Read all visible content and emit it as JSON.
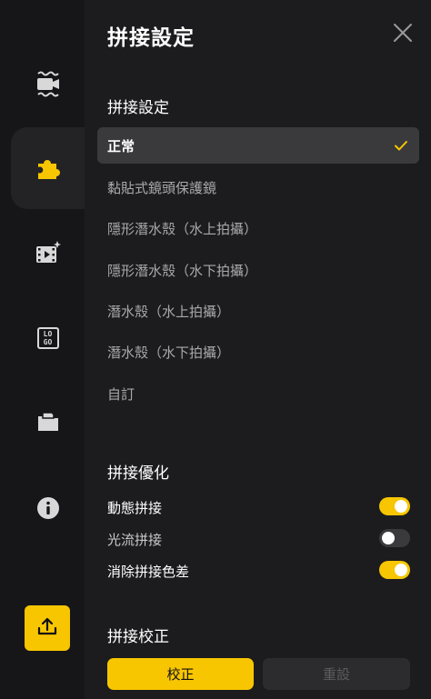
{
  "panel": {
    "title": "拼接設定"
  },
  "stitch_settings": {
    "heading": "拼接設定",
    "options": [
      {
        "label": "正常",
        "selected": true
      },
      {
        "label": "黏貼式鏡頭保護鏡",
        "selected": false
      },
      {
        "label": "隱形潛水殼（水上拍攝）",
        "selected": false
      },
      {
        "label": "隱形潛水殼（水下拍攝）",
        "selected": false
      },
      {
        "label": "潛水殼（水上拍攝）",
        "selected": false
      },
      {
        "label": "潛水殼（水下拍攝）",
        "selected": false
      },
      {
        "label": "自訂",
        "selected": false
      }
    ]
  },
  "stitch_optimize": {
    "heading": "拼接優化",
    "toggles": [
      {
        "label": "動態拼接",
        "on": true
      },
      {
        "label": "光流拼接",
        "on": false
      },
      {
        "label": "消除拼接色差",
        "on": true
      }
    ]
  },
  "stitch_calibrate": {
    "heading": "拼接校正",
    "calibrate_label": "校正",
    "reset_label": "重設"
  },
  "sidebar": {
    "items": [
      {
        "icon": "underwater-camera-icon",
        "active": false
      },
      {
        "icon": "puzzle-piece-icon",
        "active": true
      },
      {
        "icon": "video-effects-icon",
        "active": false
      },
      {
        "icon": "logo-icon",
        "active": false
      },
      {
        "icon": "folder-icon",
        "active": false
      },
      {
        "icon": "info-icon",
        "active": false
      }
    ],
    "logo_text_top": "LO",
    "logo_text_bottom": "GO",
    "upload_icon": "upload-icon"
  },
  "colors": {
    "accent": "#f7c600",
    "background": "#1c1c1e",
    "sidebar": "#161618",
    "selected_row": "#3a3a3c"
  }
}
